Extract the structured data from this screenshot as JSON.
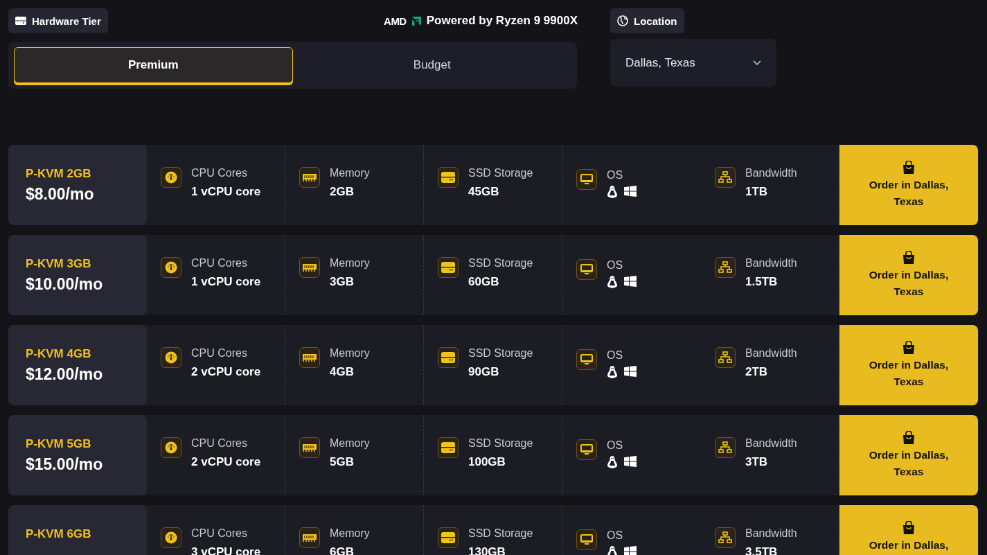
{
  "hardware_tier": {
    "label": "Hardware Tier",
    "tabs": [
      {
        "label": "Premium",
        "selected": true
      },
      {
        "label": "Budget",
        "selected": false
      }
    ]
  },
  "processor": {
    "brand": "AMD",
    "label": "Powered by Ryzen 9 9900X"
  },
  "location": {
    "label": "Location",
    "value": "Dallas, Texas"
  },
  "plans": [
    {
      "name": "P-KVM 2GB",
      "price": "$8.00/mo",
      "specs": [
        {
          "kind": "cpu",
          "label": "CPU Cores",
          "value": "1 vCPU core"
        },
        {
          "kind": "memory",
          "label": "Memory",
          "value": "2GB"
        },
        {
          "kind": "storage",
          "label": "SSD Storage",
          "value": "45GB"
        },
        {
          "kind": "os",
          "label": "OS"
        },
        {
          "kind": "bandwidth",
          "label": "Bandwidth",
          "value": "1TB"
        }
      ],
      "order": "Order in Dallas, Texas"
    },
    {
      "name": "P-KVM 3GB",
      "price": "$10.00/mo",
      "specs": [
        {
          "kind": "cpu",
          "label": "CPU Cores",
          "value": "1 vCPU core"
        },
        {
          "kind": "memory",
          "label": "Memory",
          "value": "3GB"
        },
        {
          "kind": "storage",
          "label": "SSD Storage",
          "value": "60GB"
        },
        {
          "kind": "os",
          "label": "OS"
        },
        {
          "kind": "bandwidth",
          "label": "Bandwidth",
          "value": "1.5TB"
        }
      ],
      "order": "Order in Dallas, Texas"
    },
    {
      "name": "P-KVM 4GB",
      "price": "$12.00/mo",
      "specs": [
        {
          "kind": "cpu",
          "label": "CPU Cores",
          "value": "2 vCPU core"
        },
        {
          "kind": "memory",
          "label": "Memory",
          "value": "4GB"
        },
        {
          "kind": "storage",
          "label": "SSD Storage",
          "value": "90GB"
        },
        {
          "kind": "os",
          "label": "OS"
        },
        {
          "kind": "bandwidth",
          "label": "Bandwidth",
          "value": "2TB"
        }
      ],
      "order": "Order in Dallas, Texas"
    },
    {
      "name": "P-KVM 5GB",
      "price": "$15.00/mo",
      "specs": [
        {
          "kind": "cpu",
          "label": "CPU Cores",
          "value": "2 vCPU core"
        },
        {
          "kind": "memory",
          "label": "Memory",
          "value": "5GB"
        },
        {
          "kind": "storage",
          "label": "SSD Storage",
          "value": "100GB"
        },
        {
          "kind": "os",
          "label": "OS"
        },
        {
          "kind": "bandwidth",
          "label": "Bandwidth",
          "value": "3TB"
        }
      ],
      "order": "Order in Dallas, Texas"
    },
    {
      "name": "P-KVM 6GB",
      "specs": [
        {
          "kind": "cpu",
          "label": "CPU Cores",
          "value": "3 vCPU core"
        },
        {
          "kind": "memory",
          "label": "Memory",
          "value": "6GB"
        },
        {
          "kind": "storage",
          "label": "SSD Storage",
          "value": "130GB"
        },
        {
          "kind": "os",
          "label": "OS"
        },
        {
          "kind": "bandwidth",
          "label": "Bandwidth",
          "value": "3.5TB"
        }
      ],
      "order": "Order in Dallas,"
    }
  ]
}
